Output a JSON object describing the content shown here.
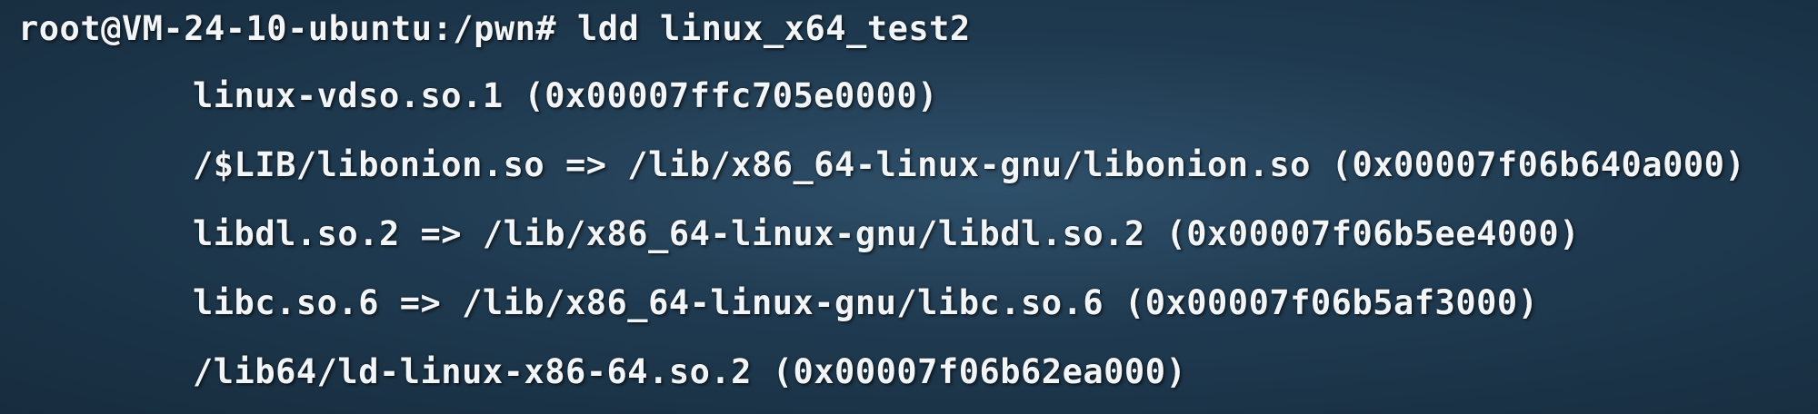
{
  "terminal": {
    "prompt": "root@VM-24-10-ubuntu:/pwn# ",
    "command": "ldd linux_x64_test2",
    "output": [
      "linux-vdso.so.1 (0x00007ffc705e0000)",
      "/$LIB/libonion.so => /lib/x86_64-linux-gnu/libonion.so (0x00007f06b640a000)",
      "libdl.so.2 => /lib/x86_64-linux-gnu/libdl.so.2 (0x00007f06b5ee4000)",
      "libc.so.6 => /lib/x86_64-linux-gnu/libc.so.6 (0x00007f06b5af3000)",
      "/lib64/ld-linux-x86-64.so.2 (0x00007f06b62ea000)"
    ]
  }
}
